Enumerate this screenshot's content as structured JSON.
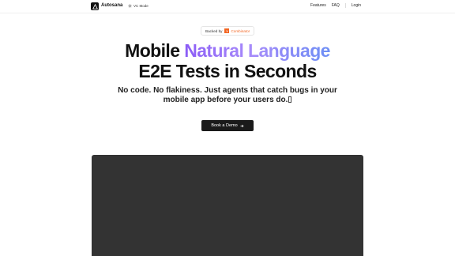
{
  "nav": {
    "brand": "Autosana",
    "vc_mode": "VC Mode",
    "links": [
      "Features",
      "FAQ",
      "Login"
    ]
  },
  "hero": {
    "badge_prefix": "Backed by",
    "badge_logo": "Y",
    "badge_name": "Combinator",
    "title_word1": "Mobile",
    "title_highlight": "Natural Language",
    "title_line2": "E2E Tests in Seconds",
    "subtitle": "No code. No flakiness. Just agents that catch bugs in your mobile app before your users do.",
    "cta": "Book a Demo"
  },
  "colors": {
    "accent_gradient": [
      "#8b5cf6",
      "#6d8ef5"
    ],
    "yc_orange": "#f26522",
    "button_bg": "#1a1a1a",
    "demo_bg": "#333333"
  },
  "icons": {
    "logo": "triangle-logo-icon",
    "vc_mode": "sun-icon",
    "cta": "arrow-right-icon",
    "cursor": "text-cursor"
  }
}
